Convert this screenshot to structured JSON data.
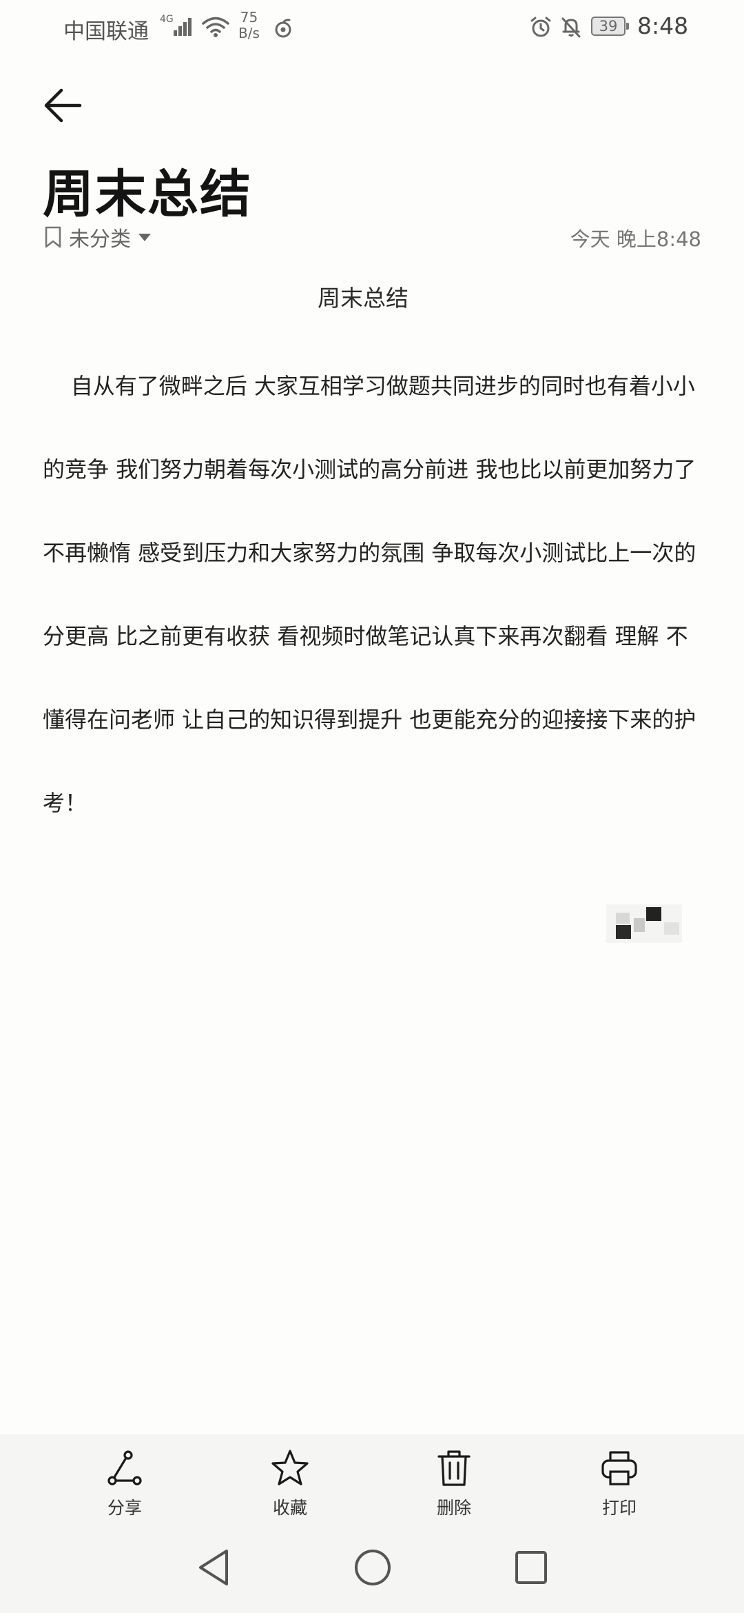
{
  "status_bar": {
    "carrier": "中国联通",
    "network_type": "4G",
    "speed_value": "75",
    "speed_unit": "B/s",
    "battery": "39",
    "time": "8:48"
  },
  "note": {
    "title": "周末总结",
    "category": "未分类",
    "timestamp": "今天 晚上8:48",
    "heading": "周末总结",
    "body": "    自从有了微畔之后 大家互相学习做题共同进步的同时也有着小小的竞争 我们努力朝着每次小测试的高分前进 我也比以前更加努力了 不再懒惰 感受到压力和大家努力的氛围 争取每次小测试比上一次的分更高 比之前更有收获 看视频时做笔记认真下来再次翻看 理解 不懂得在问老师 让自己的知识得到提升 也更能充分的迎接接下来的护考！"
  },
  "toolbar": {
    "share": "分享",
    "favorite": "收藏",
    "delete": "删除",
    "print": "打印"
  },
  "icons": {
    "back": "arrow-left-icon",
    "category": "bookmark-icon",
    "dropdown": "caret-down-icon",
    "share": "share-icon",
    "favorite": "star-icon",
    "delete": "trash-icon",
    "print": "printer-icon",
    "nav_back": "triangle-back-icon",
    "nav_home": "circle-home-icon",
    "nav_recents": "square-recents-icon"
  }
}
